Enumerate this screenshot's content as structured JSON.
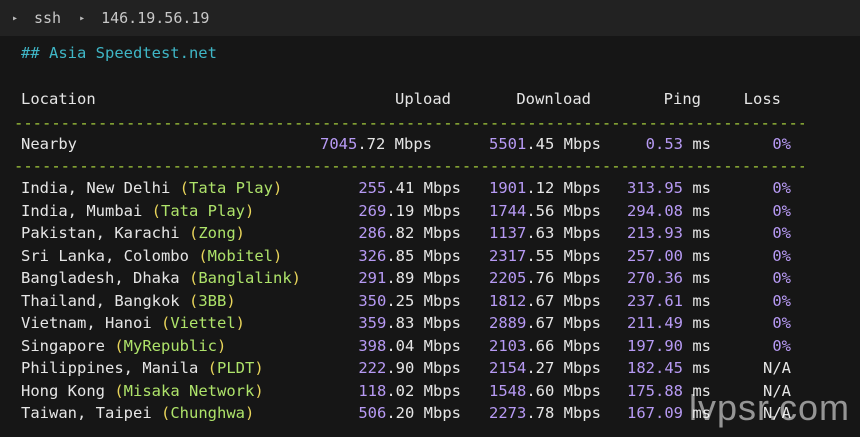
{
  "titlebar": {
    "segment": "ssh",
    "host": "146.19.56.19"
  },
  "heading": "## Asia Speedtest.net",
  "columns": {
    "location": "Location",
    "upload": "Upload",
    "download": "Download",
    "ping": "Ping",
    "loss": "Loss"
  },
  "separator": "----------------------------------------------------------------------------------------------------",
  "nearby": {
    "location": "Nearby",
    "upload_int": "7045",
    "upload_dec": ".72",
    "upload_unit": " Mbps",
    "download_int": "5501",
    "download_dec": ".45",
    "download_unit": " Mbps",
    "ping": "0.53",
    "ping_unit": " ms",
    "loss": "0%"
  },
  "rows": [
    {
      "place": "India, New Delhi ",
      "isp": "Tata Play",
      "up_int": "255",
      "up_dec": ".41",
      "dl_int": "1901",
      "dl_dec": ".12",
      "ping": "313.95",
      "loss": "0%"
    },
    {
      "place": "India, Mumbai ",
      "isp": "Tata Play",
      "up_int": "269",
      "up_dec": ".19",
      "dl_int": "1744",
      "dl_dec": ".56",
      "ping": "294.08",
      "loss": "0%"
    },
    {
      "place": "Pakistan, Karachi ",
      "isp": "Zong",
      "up_int": "286",
      "up_dec": ".82",
      "dl_int": "1137",
      "dl_dec": ".63",
      "ping": "213.93",
      "loss": "0%"
    },
    {
      "place": "Sri Lanka, Colombo ",
      "isp": "Mobitel",
      "up_int": "326",
      "up_dec": ".85",
      "dl_int": "2317",
      "dl_dec": ".55",
      "ping": "257.00",
      "loss": "0%"
    },
    {
      "place": "Bangladesh, Dhaka ",
      "isp": "Banglalink",
      "up_int": "291",
      "up_dec": ".89",
      "dl_int": "2205",
      "dl_dec": ".76",
      "ping": "270.36",
      "loss": "0%"
    },
    {
      "place": "Thailand, Bangkok ",
      "isp": "3BB",
      "up_int": "350",
      "up_dec": ".25",
      "dl_int": "1812",
      "dl_dec": ".67",
      "ping": "237.61",
      "loss": "0%"
    },
    {
      "place": "Vietnam, Hanoi ",
      "isp": "Viettel",
      "up_int": "359",
      "up_dec": ".83",
      "dl_int": "2889",
      "dl_dec": ".67",
      "ping": "211.49",
      "loss": "0%"
    },
    {
      "place": "Singapore ",
      "isp": "MyRepublic",
      "up_int": "398",
      "up_dec": ".04",
      "dl_int": "2103",
      "dl_dec": ".66",
      "ping": "197.90",
      "loss": "0%"
    },
    {
      "place": "Philippines, Manila ",
      "isp": "PLDT",
      "up_int": "222",
      "up_dec": ".90",
      "dl_int": "2154",
      "dl_dec": ".27",
      "ping": "182.45",
      "loss": "N/A"
    },
    {
      "place": "Hong Kong ",
      "isp": "Misaka Network",
      "up_int": "118",
      "up_dec": ".02",
      "dl_int": "1548",
      "dl_dec": ".60",
      "ping": "175.88",
      "loss": "N/A"
    },
    {
      "place": "Taiwan, Taipei ",
      "isp": "Chunghwa",
      "up_int": "506",
      "up_dec": ".20",
      "dl_int": "2273",
      "dl_dec": ".78",
      "ping": "167.09",
      "loss": "N/A"
    }
  ],
  "units": {
    "mbps": " Mbps",
    "ms": " ms"
  },
  "watermark": "lvpsr.com",
  "colors": {
    "background": "#161616",
    "heading": "#3fb6c6",
    "separator": "#a5cf3d",
    "number": "#b79af4",
    "paren": "#e8d45a",
    "isp": "#aee36a"
  }
}
